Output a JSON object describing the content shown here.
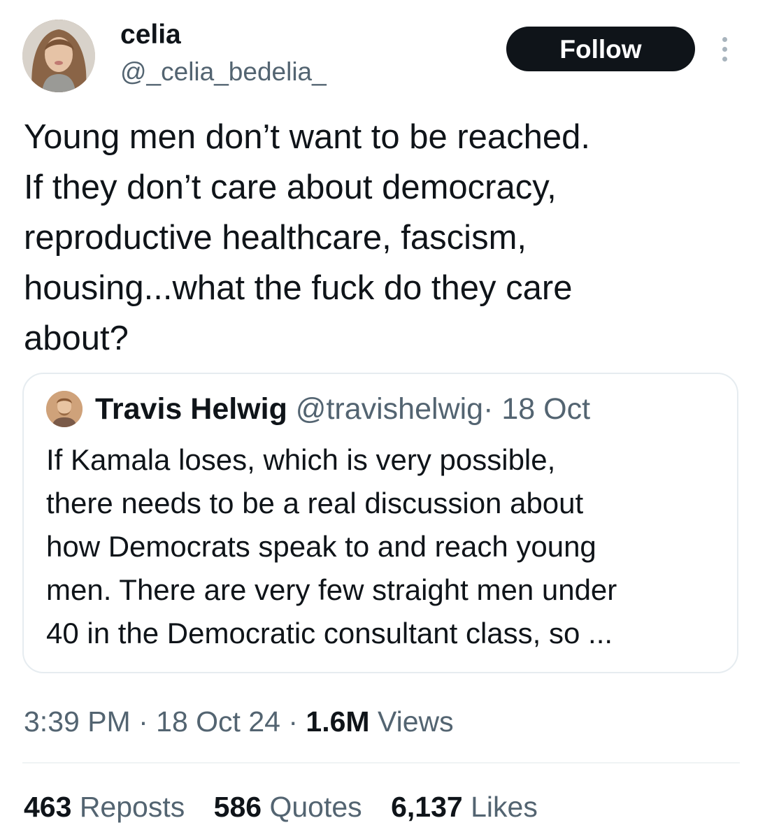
{
  "author": {
    "display_name": "celia",
    "handle": "@_celia_bedelia_"
  },
  "follow_button": {
    "label": "Follow"
  },
  "tweet": {
    "text_lines": [
      "Young men don’t want to be reached.",
      "If they don’t care about democracy,",
      "reproductive healthcare, fascism,",
      "housing...what the fuck do they care",
      "about?"
    ]
  },
  "quoted_tweet": {
    "display_name": "Travis Helwig",
    "handle": "@travishelwig",
    "separator": "·",
    "date": "18 Oct",
    "text_lines": [
      "If Kamala loses, which is very possible,",
      "there needs to be a real discussion about",
      "how Democrats speak to and reach young",
      "men. There are very few straight men under",
      "40 in the Democratic consultant class, so ..."
    ]
  },
  "meta": {
    "time": "3:39 PM",
    "sep1": "·",
    "date": "18 Oct 24",
    "sep2": "·",
    "views_count": "1.6M",
    "views_label": "Views"
  },
  "stats": {
    "reposts_count": "463",
    "reposts_label": "Reposts",
    "quotes_count": "586",
    "quotes_label": "Quotes",
    "likes_count": "6,137",
    "likes_label": "Likes"
  },
  "icons": {
    "more": "more-options-icon"
  },
  "colors": {
    "text_primary": "#0f1419",
    "text_secondary": "#536471",
    "follow_bg": "#0f1419",
    "border": "#e6ecf0"
  }
}
